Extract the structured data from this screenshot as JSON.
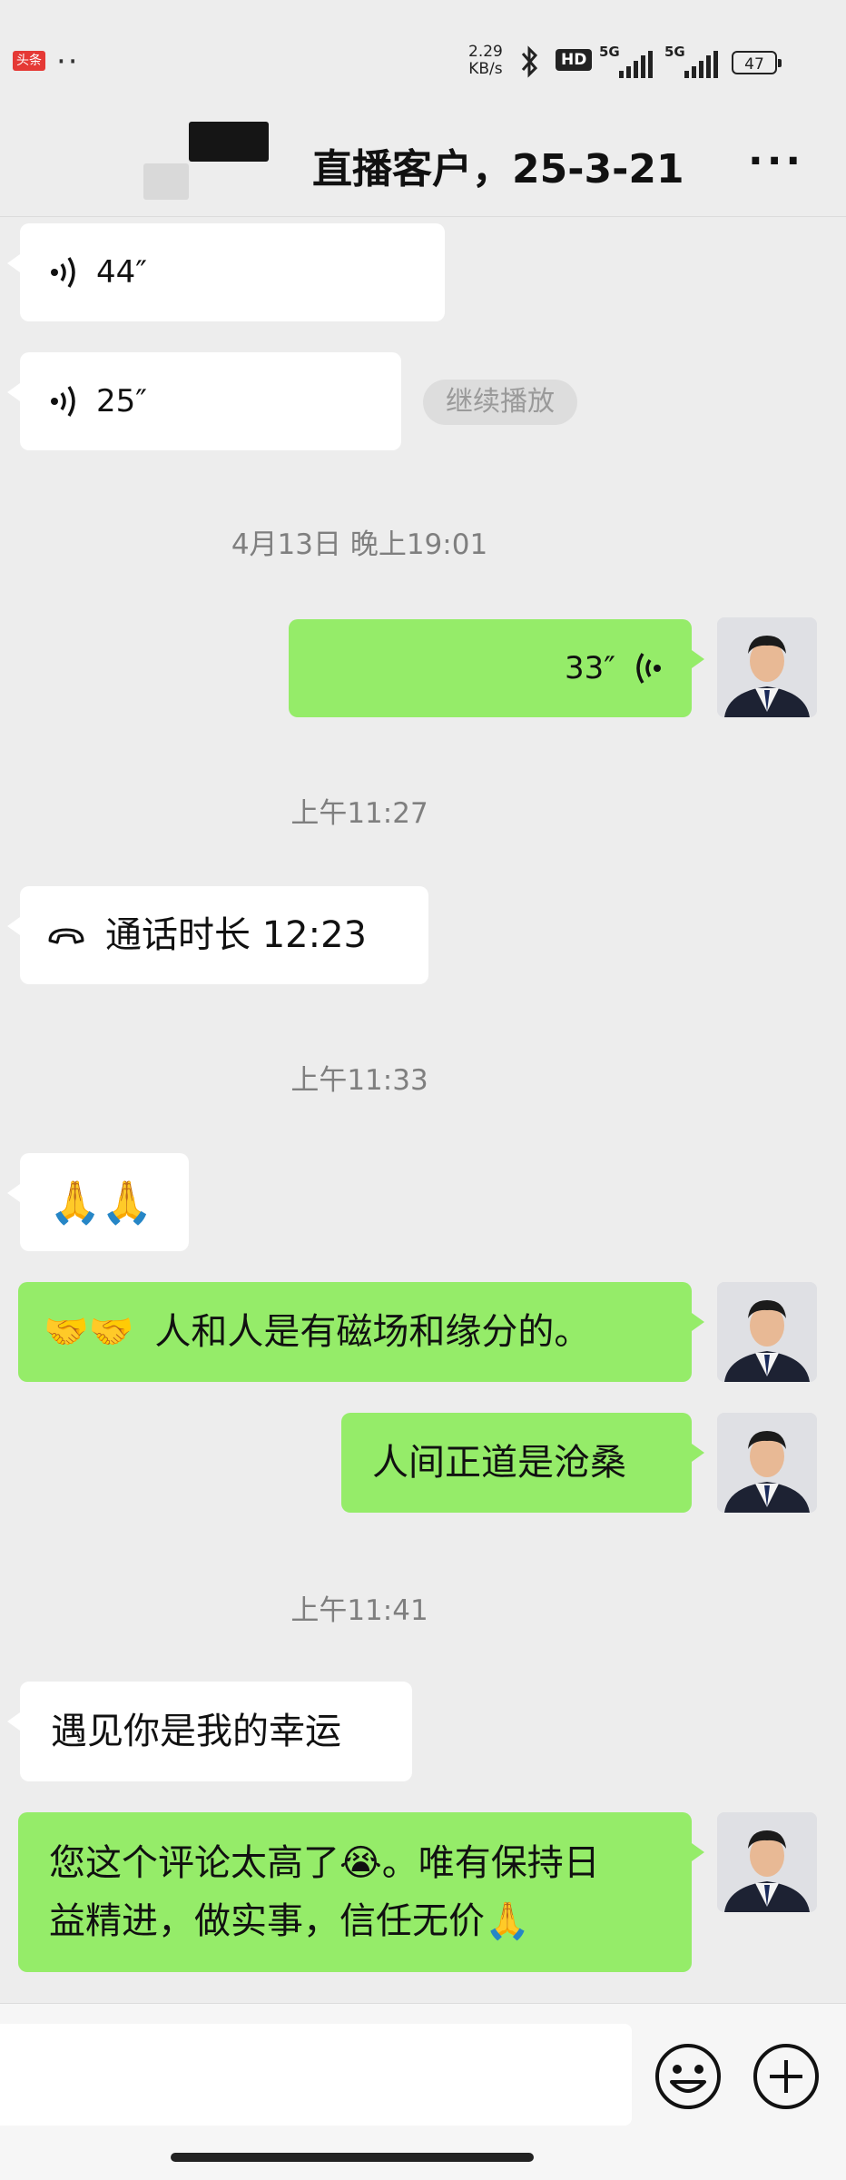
{
  "status_bar": {
    "app_badge": "头条",
    "net_speed_value": "2.29",
    "net_speed_unit": "KB/s",
    "hd_label": "HD",
    "signal1_label": "5G",
    "signal2_label": "5G",
    "battery": "47"
  },
  "header": {
    "title": "直播客户，25-3-21",
    "more": "···"
  },
  "messages": {
    "voice1_duration": "44″",
    "voice2_duration": "25″",
    "continue_label": "继续播放",
    "time1": "4月13日 晚上19:01",
    "voice3_duration": "33″",
    "time2": "上午11:27",
    "call_text": "通话时长 12:23",
    "time3": "上午11:33",
    "pray_emoji": "🙏🙏",
    "msg_handshake_emoji": "🤝🤝",
    "msg_handshake_text": "人和人是有磁场和缘分的。",
    "msg_zhengdao": "人间正道是沧桑",
    "time4": "上午11:41",
    "msg_lucky": "遇见你是我的幸运",
    "msg_last_line1_a": "您这个评论太高了",
    "msg_last_line1_emoji": "😭",
    "msg_last_line1_b": "。唯有保持日",
    "msg_last_line2": "益精进，做实事，信任无价",
    "msg_last_line2_emoji": "🙏"
  },
  "colors": {
    "background": "#ededed",
    "self_bubble": "#95ec69",
    "other_bubble": "#ffffff",
    "timestamp": "#7f7f7f"
  },
  "icons": [
    "voice-left-icon",
    "voice-right-icon",
    "phone-hangup-icon",
    "emoji-icon",
    "plus-icon",
    "bluetooth-icon",
    "signal-icon",
    "battery-icon"
  ]
}
